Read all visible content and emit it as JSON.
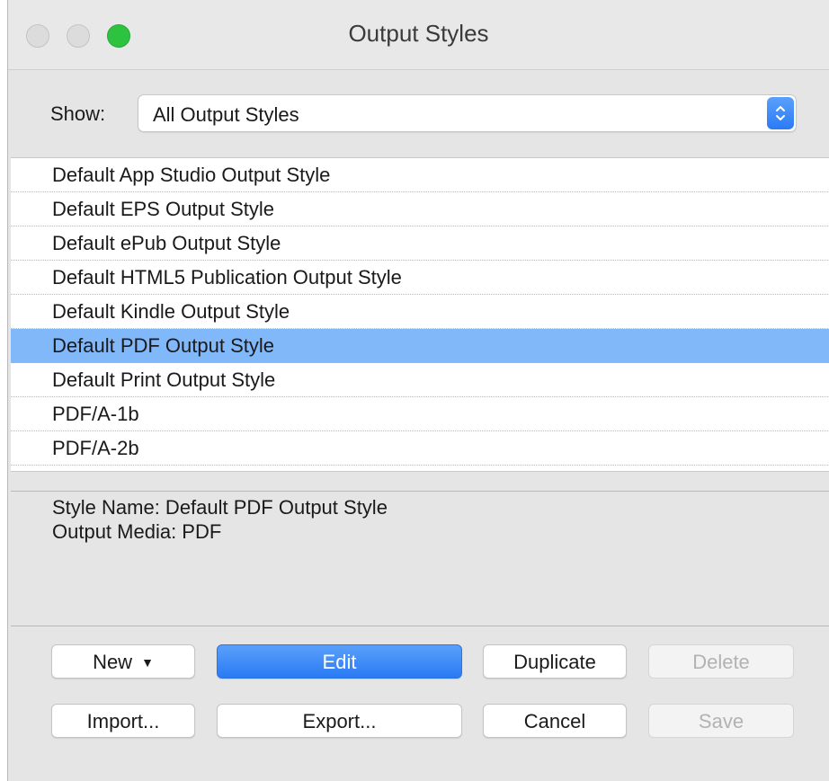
{
  "window": {
    "title": "Output Styles"
  },
  "show": {
    "label": "Show:",
    "selected": "All Output Styles"
  },
  "list": {
    "items": [
      "Default App Studio Output Style",
      "Default EPS Output Style",
      "Default ePub Output Style",
      "Default HTML5 Publication Output Style",
      "Default Kindle Output Style",
      "Default PDF Output Style",
      "Default Print Output Style",
      "PDF/A-1b",
      "PDF/A-2b"
    ],
    "selected_index": 5
  },
  "info": {
    "style_name": "Style Name: Default PDF Output Style",
    "output_media": "Output Media: PDF"
  },
  "buttons": {
    "new": "New",
    "edit": "Edit",
    "duplicate": "Duplicate",
    "delete": "Delete",
    "import": "Import...",
    "export": "Export...",
    "cancel": "Cancel",
    "save": "Save"
  },
  "colors": {
    "selection": "#80b8f9",
    "accent": "#2a7af5",
    "zoom_button": "#2dc23f"
  }
}
